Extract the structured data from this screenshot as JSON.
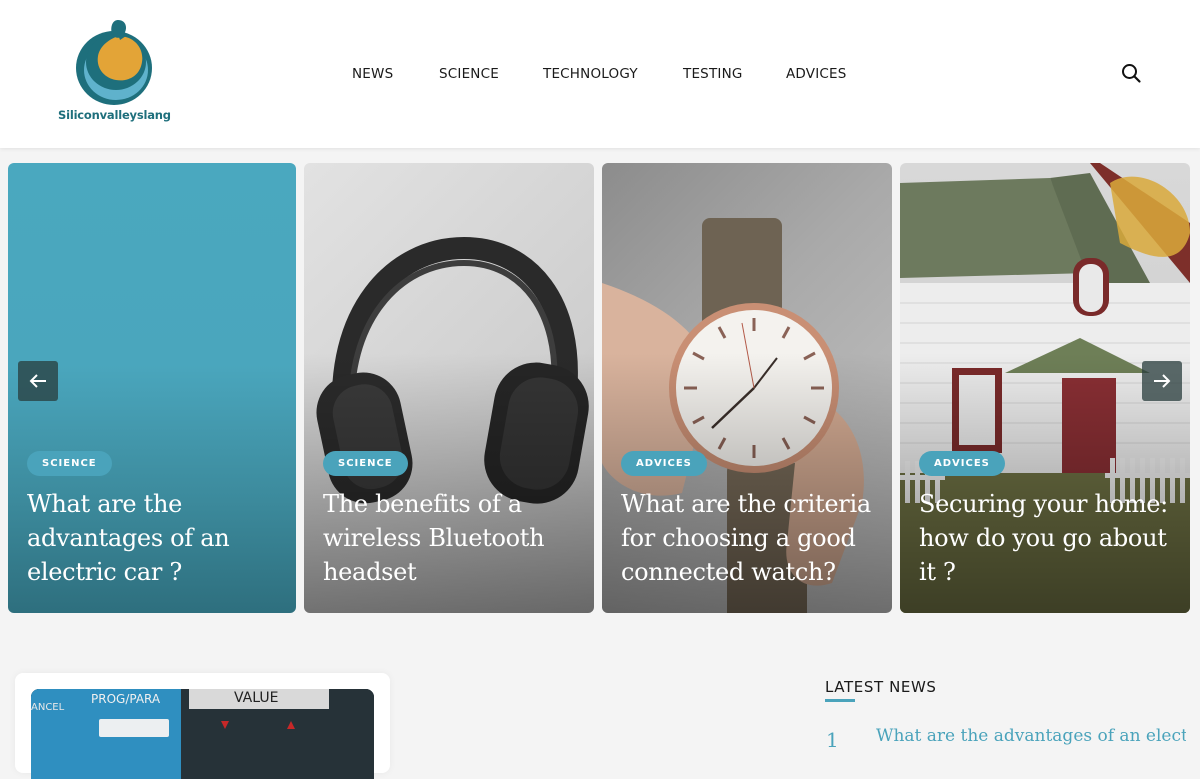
{
  "site": {
    "logo_text": "Siliconvalleyslang",
    "colors": {
      "accent": "#4aa3bb",
      "logo_teal": "#1e6f7c",
      "logo_orange": "#e3a437"
    }
  },
  "nav": {
    "items": [
      {
        "label": "NEWS"
      },
      {
        "label": "SCIENCE"
      },
      {
        "label": "TECHNOLOGY"
      },
      {
        "label": "TESTING"
      },
      {
        "label": "ADVICES"
      }
    ],
    "search_icon": "search-icon"
  },
  "slider": {
    "prev_icon": "arrow-left-icon",
    "next_icon": "arrow-right-icon",
    "cards": [
      {
        "category": "SCIENCE",
        "title": "What are the advantages of an electric car ?"
      },
      {
        "category": "SCIENCE",
        "title": "The benefits of a wireless Bluetooth headset"
      },
      {
        "category": "ADVICES",
        "title": "What are the criteria for choosing a good connected watch?"
      },
      {
        "category": "ADVICES",
        "title": "Securing your home: how do you go about it ?"
      }
    ]
  },
  "featured": {
    "image_labels": {
      "left": "ANCEL",
      "middle": "PROG/PARA",
      "right": "VALUE"
    }
  },
  "latest": {
    "heading": "LATEST NEWS",
    "items": [
      {
        "num": "1",
        "title": "What are the advantages of an electric car ?"
      }
    ]
  }
}
